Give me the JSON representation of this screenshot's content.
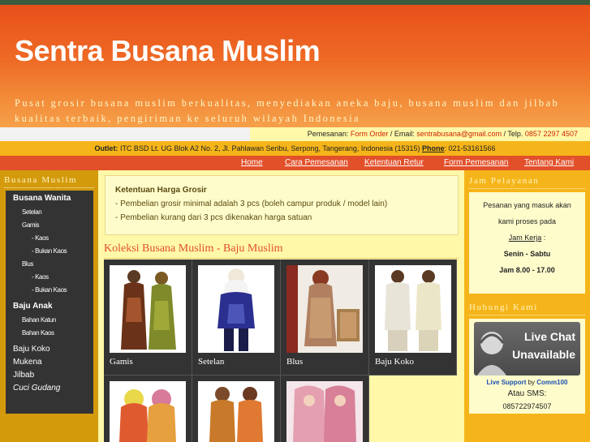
{
  "header": {
    "title": "Sentra Busana Muslim",
    "tagline": "Pusat grosir busana muslim berkualitas, menyediakan aneka baju, busana muslim dan jilbab kualitas terbaik, pengiriman ke seluruh wilayah Indonesia"
  },
  "contact_bar": {
    "pemesanan_label": "Pemesanan: ",
    "form_order": "Form Order",
    "email_label": " / Email: ",
    "email": "sentrabusana@gmail.com",
    "telp_label": " / Telp. ",
    "telp": "0857 2297 4507"
  },
  "outlet_bar": {
    "outlet_label": "Outlet:",
    "address": " ITC BSD Lt. UG Blok A2 No. 2, Jl. Pahlawan Seribu, Serpong, Tangerang, Indonesia (15315) ",
    "phone_label": "Phone",
    "phone": ": 021-53161566"
  },
  "nav": {
    "items": [
      "Home",
      "Cara Pemesanan",
      "Ketentuan Retur",
      "Form Pemesanan",
      "Tentang Kami"
    ]
  },
  "left": {
    "title": "Busana Muslim",
    "menu": {
      "busana_wanita": "Busana Wanita",
      "setelan": "Setelan",
      "gamis": "Gamis",
      "gamis_kaos": "- Kaos",
      "gamis_bukan_kaos": "- Bukan Kaos",
      "blus": "Blus",
      "blus_kaos": "- Kaos",
      "blus_bukan_kaos": "- Bukan Kaos",
      "baju_anak": "Baju Anak",
      "bahan_katun": "Bahan Katun",
      "bahan_kaos": "Bahan Kaos",
      "baju_koko": "Baju Koko",
      "mukena": "Mukena",
      "jilbab": "Jilbab",
      "cuci_gudang": "Cuci Gudang"
    }
  },
  "main": {
    "terms_title": "Ketentuan Harga Grosir",
    "terms_1": "- Pembelian grosir minimal adalah 3 pcs (boleh campur produk / model lain)",
    "terms_2": "- Pembelian kurang dari 3 pcs dikenakan harga satuan",
    "section_title": "Koleksi Busana Muslim - Baju Muslim",
    "products": [
      "Gamis",
      "Setelan",
      "Blus",
      "Baju Koko"
    ]
  },
  "right": {
    "hours_title": "Jam Pelayanan",
    "hours_1": "Pesanan yang masuk akan",
    "hours_2": "kami proses pada",
    "hours_3": "Jam Kerja",
    "hours_3_suffix": " :",
    "hours_4": "Senin - Sabtu",
    "hours_5": "Jam 8.00 - 17.00",
    "contact_title": "Hubungi Kami",
    "live_chat_1": "Live Chat",
    "live_chat_2": "Unavailable",
    "live_support": "Live Support",
    "by": " by ",
    "comm100": "Comm100",
    "atau_sms": "Atau SMS:",
    "sms_number": "085722974507"
  },
  "colors": {
    "header_orange": "#e8501a",
    "nav_red": "#e2502a",
    "left_gold": "#d39a0c",
    "menu_dark": "#333333",
    "main_yellow": "#fff8a8",
    "right_gold": "#f5b51a"
  }
}
